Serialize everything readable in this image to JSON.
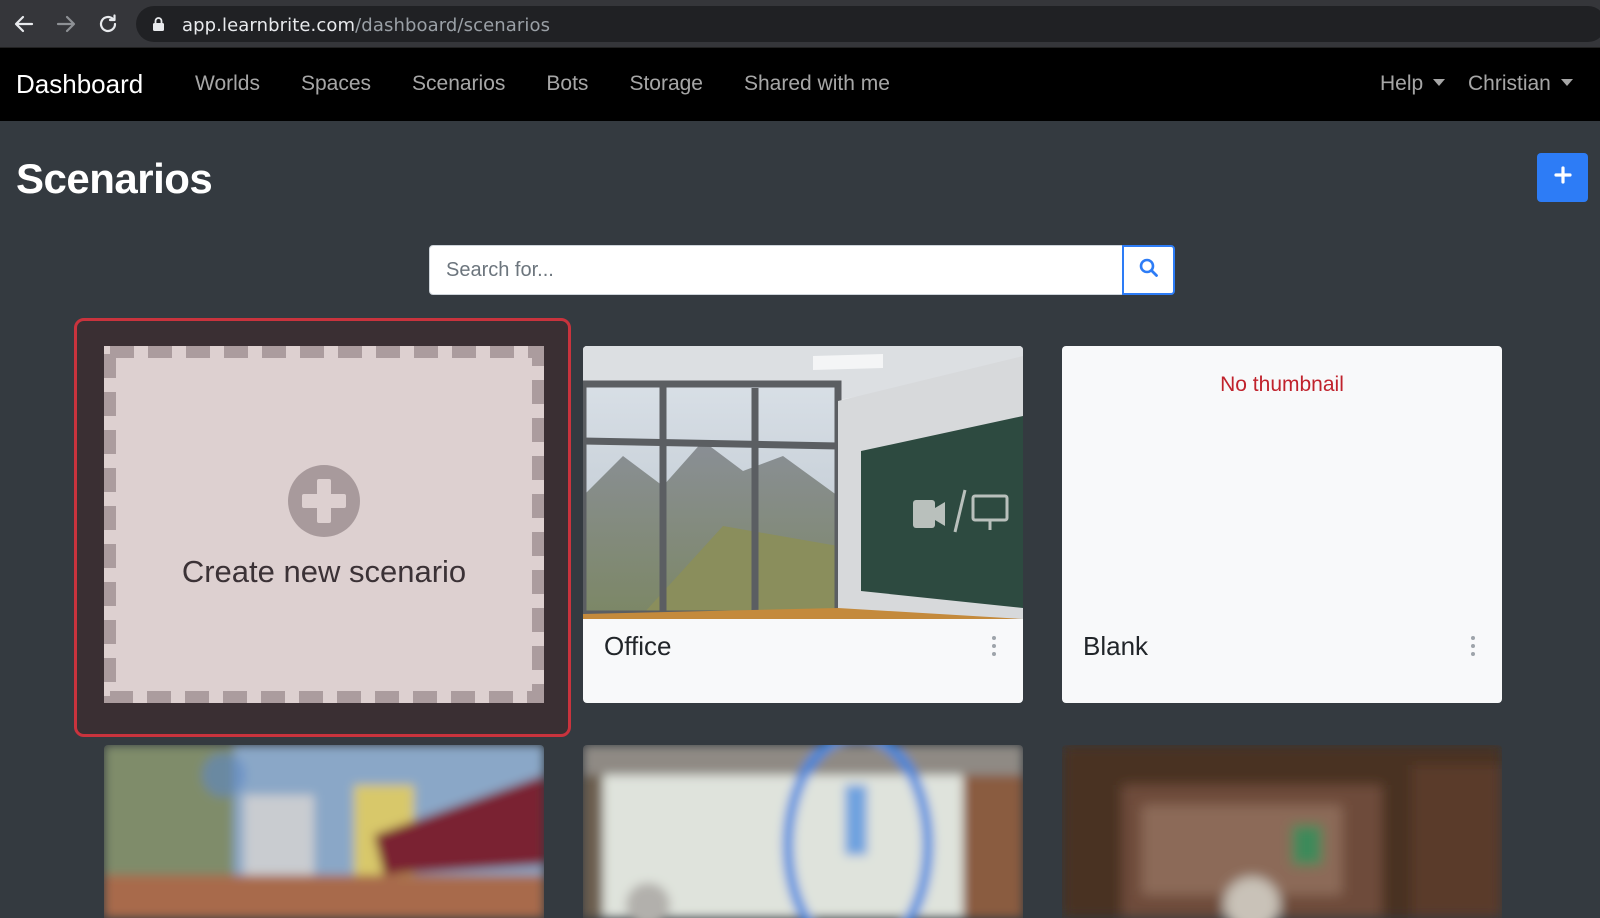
{
  "browser": {
    "url_host": "app.learnbrite.com",
    "url_path": "/dashboard/scenarios",
    "icons": [
      "back-arrow-icon",
      "forward-arrow-icon",
      "reload-icon",
      "lock-icon"
    ]
  },
  "navbar": {
    "brand": "Dashboard",
    "links": [
      "Worlds",
      "Spaces",
      "Scenarios",
      "Bots",
      "Storage",
      "Shared with me"
    ],
    "help_label": "Help",
    "user_label": "Christian"
  },
  "page": {
    "title": "Scenarios",
    "add_button_icon": "plus-icon"
  },
  "search": {
    "placeholder": "Search for...",
    "value": "",
    "button_icon": "search-icon"
  },
  "cards": {
    "create_label": "Create new scenario",
    "items": [
      {
        "title": "Office"
      },
      {
        "title": "Blank",
        "no_thumbnail_text": "No thumbnail"
      }
    ]
  },
  "colors": {
    "accent": "#2d7cf6",
    "highlight_border": "#c9333d",
    "navbar": "#000000",
    "page_bg": "#343a40",
    "no_thumbnail_text": "#c0222c"
  }
}
